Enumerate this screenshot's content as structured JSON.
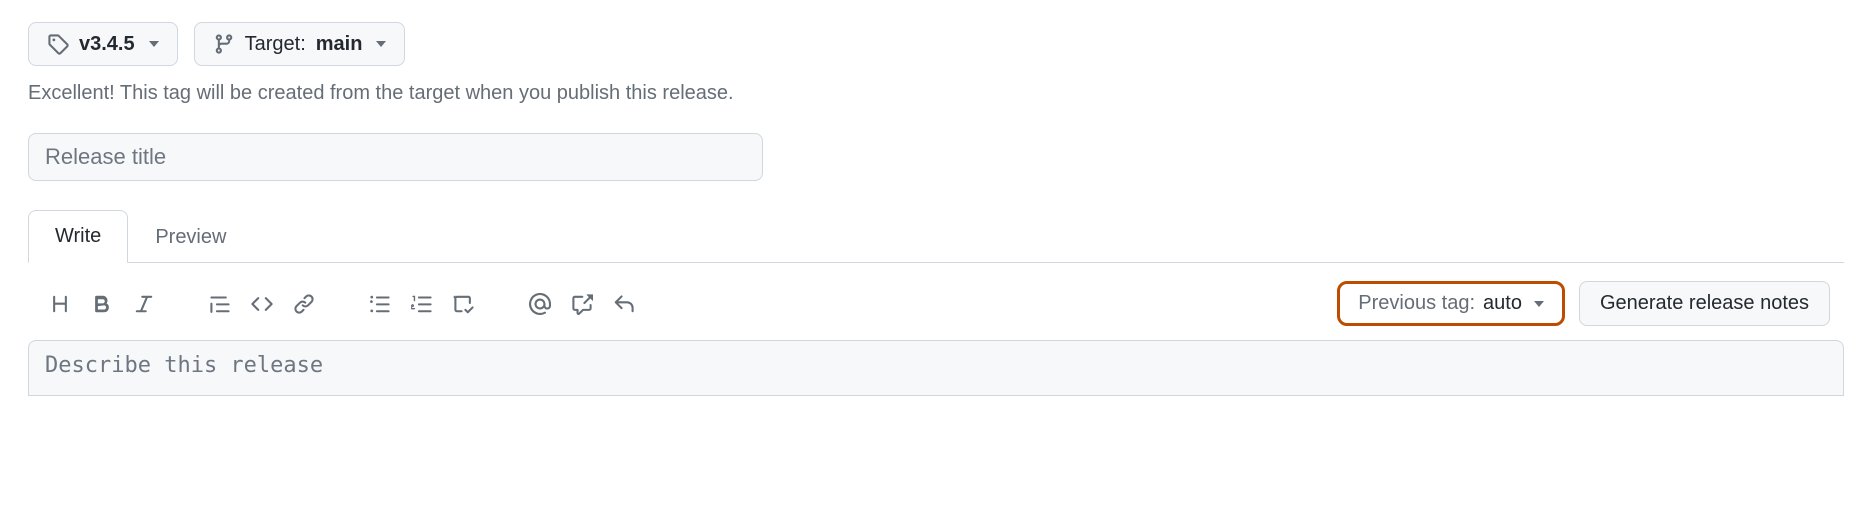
{
  "tag_selector": {
    "tag": "v3.4.5",
    "target_label": "Target:",
    "target_branch": "main"
  },
  "helper_text": "Excellent! This tag will be created from the target when you publish this release.",
  "title_input": {
    "value": "",
    "placeholder": "Release title"
  },
  "tabs": {
    "write": "Write",
    "preview": "Preview"
  },
  "previous_tag": {
    "label": "Previous tag:",
    "value": "auto"
  },
  "generate_notes_label": "Generate release notes",
  "description": {
    "value": "",
    "placeholder": "Describe this release"
  },
  "icons": {
    "tag": "tag-icon",
    "branch": "git-branch-icon",
    "heading": "heading-icon",
    "bold": "bold-icon",
    "italic": "italic-icon",
    "quote": "quote-icon",
    "code": "code-icon",
    "link": "link-icon",
    "ul": "unordered-list-icon",
    "ol": "ordered-list-icon",
    "tasklist": "tasklist-icon",
    "mention": "mention-icon",
    "crossref": "cross-reference-icon",
    "reply": "reply-icon"
  }
}
